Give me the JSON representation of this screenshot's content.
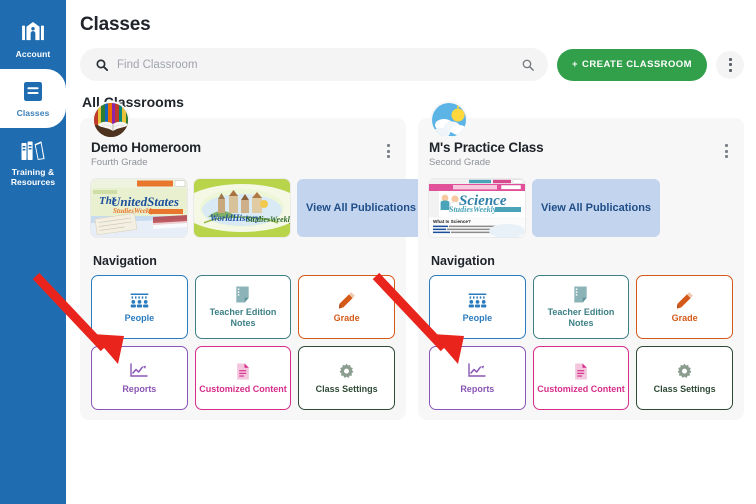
{
  "colors": {
    "sidebar_blue": "#1f6cb0",
    "create_green": "#32a04b",
    "viewall_bg": "#c3d4ef",
    "viewall_text": "#1f4e88",
    "card_bg": "#f7f7f7",
    "annotation_red": "#e8241d",
    "people_color": "#2b7cbf",
    "notes_color": "#3c7f85",
    "grade_color": "#d45a19",
    "reports_color": "#8a56b5",
    "customized_color": "#d62d8a",
    "settings_color": "#2f4a35"
  },
  "sidebar": {
    "items": [
      {
        "label": "Account",
        "icon": "school-icon",
        "active": false
      },
      {
        "label": "Classes",
        "icon": "book-icon",
        "active": true
      },
      {
        "label": "Training & Resources",
        "icon": "books-icon",
        "active": false
      }
    ]
  },
  "header": {
    "page_title": "Classes"
  },
  "search": {
    "placeholder": "Find Classroom",
    "value": "",
    "left_icon": "search-icon",
    "right_icon": "search-icon"
  },
  "toolbar": {
    "create_label": "CREATE CLASSROOM",
    "create_plus": "+",
    "overflow_icon": "kebab-menu-icon"
  },
  "main": {
    "section_title": "All Classrooms",
    "nav_heading": "Navigation",
    "view_all_label": "View All Publications"
  },
  "nav_tiles": [
    {
      "label": "People",
      "icon": "people-icon",
      "color": "#2b7cbf"
    },
    {
      "label": "Teacher Edition Notes",
      "icon": "note-icon",
      "color": "#3c7f85"
    },
    {
      "label": "Grade",
      "icon": "pencil-icon",
      "color": "#d45a19"
    },
    {
      "label": "Reports",
      "icon": "chart-icon",
      "color": "#8a56b5"
    },
    {
      "label": "Customized Content",
      "icon": "document-icon",
      "color": "#d62d8a"
    },
    {
      "label": "Class Settings",
      "icon": "gear-icon",
      "color": "#2f4a35"
    }
  ],
  "classrooms": [
    {
      "title": "Demo Homeroom",
      "grade": "Fourth Grade",
      "avatar": "open-book-bookshelf-avatar",
      "publications": [
        {
          "name": "The United States Studies Weekly",
          "thumb": "us-studies-weekly-cover"
        },
        {
          "name": "World History Studies Weekly",
          "thumb": "world-history-studies-weekly-cover"
        }
      ]
    },
    {
      "title": "M's Practice Class",
      "grade": "Second Grade",
      "avatar": "sun-clouds-weather-avatar",
      "publications": [
        {
          "name": "Science Studies Weekly",
          "thumb": "science-studies-weekly-cover"
        }
      ]
    }
  ],
  "annotations": [
    {
      "type": "arrow",
      "color": "#e8241d",
      "points_to": "people-tile-card-1"
    },
    {
      "type": "arrow",
      "color": "#e8241d",
      "points_to": "people-tile-card-2"
    }
  ]
}
